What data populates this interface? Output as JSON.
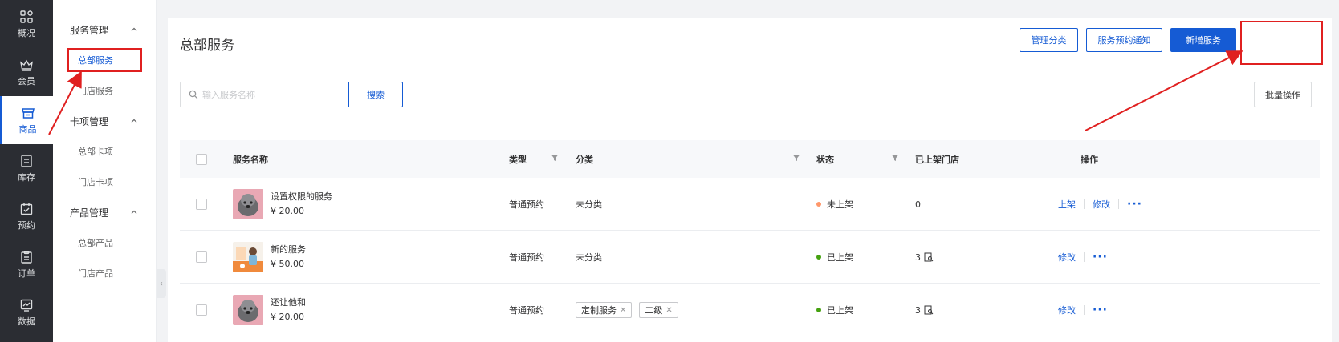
{
  "nav1": {
    "items": [
      {
        "label": "概况",
        "icon": "grid-icon"
      },
      {
        "label": "会员",
        "icon": "crown-icon"
      },
      {
        "label": "商品",
        "icon": "store-icon"
      },
      {
        "label": "库存",
        "icon": "inventory-icon"
      },
      {
        "label": "预约",
        "icon": "calendar-check-icon"
      },
      {
        "label": "订单",
        "icon": "order-icon"
      },
      {
        "label": "数据",
        "icon": "chart-icon"
      }
    ],
    "active": "商品"
  },
  "nav2": {
    "groups": [
      {
        "label": "服务管理",
        "items": [
          "总部服务",
          "门店服务"
        ]
      },
      {
        "label": "卡项管理",
        "items": [
          "总部卡项",
          "门店卡项"
        ]
      },
      {
        "label": "产品管理",
        "items": [
          "总部产品",
          "门店产品"
        ]
      }
    ],
    "active": "总部服务"
  },
  "page": {
    "title": "总部服务",
    "buttons": {
      "manage_category": "管理分类",
      "booking_notice": "服务预约通知",
      "add_service": "新增服务",
      "batch": "批量操作"
    },
    "search": {
      "placeholder": "输入服务名称",
      "button": "搜索"
    }
  },
  "table": {
    "headers": {
      "name": "服务名称",
      "type": "类型",
      "category": "分类",
      "status": "状态",
      "stores": "已上架门店",
      "actions": "操作"
    },
    "rows": [
      {
        "name": "设置权限的服务",
        "price": "¥ 20.00",
        "type": "普通预约",
        "category": "未分类",
        "tags": [],
        "status": "未上架",
        "status_color": "#ff976a",
        "stores": "0",
        "actions": [
          "上架",
          "修改"
        ]
      },
      {
        "name": "新的服务",
        "price": "¥ 50.00",
        "type": "普通预约",
        "category": "未分类",
        "tags": [],
        "status": "已上架",
        "status_color": "#45a110",
        "stores": "3",
        "actions": [
          "修改"
        ]
      },
      {
        "name": "还让他和",
        "price": "¥ 20.00",
        "type": "普通预约",
        "category": "",
        "tags": [
          "定制服务",
          "二级"
        ],
        "status": "已上架",
        "status_color": "#45a110",
        "stores": "3",
        "actions": [
          "修改"
        ]
      }
    ],
    "more_label": "···"
  },
  "colors": {
    "primary": "#155bd4",
    "nav_bg": "#2b2d33",
    "highlight": "#e02020"
  }
}
